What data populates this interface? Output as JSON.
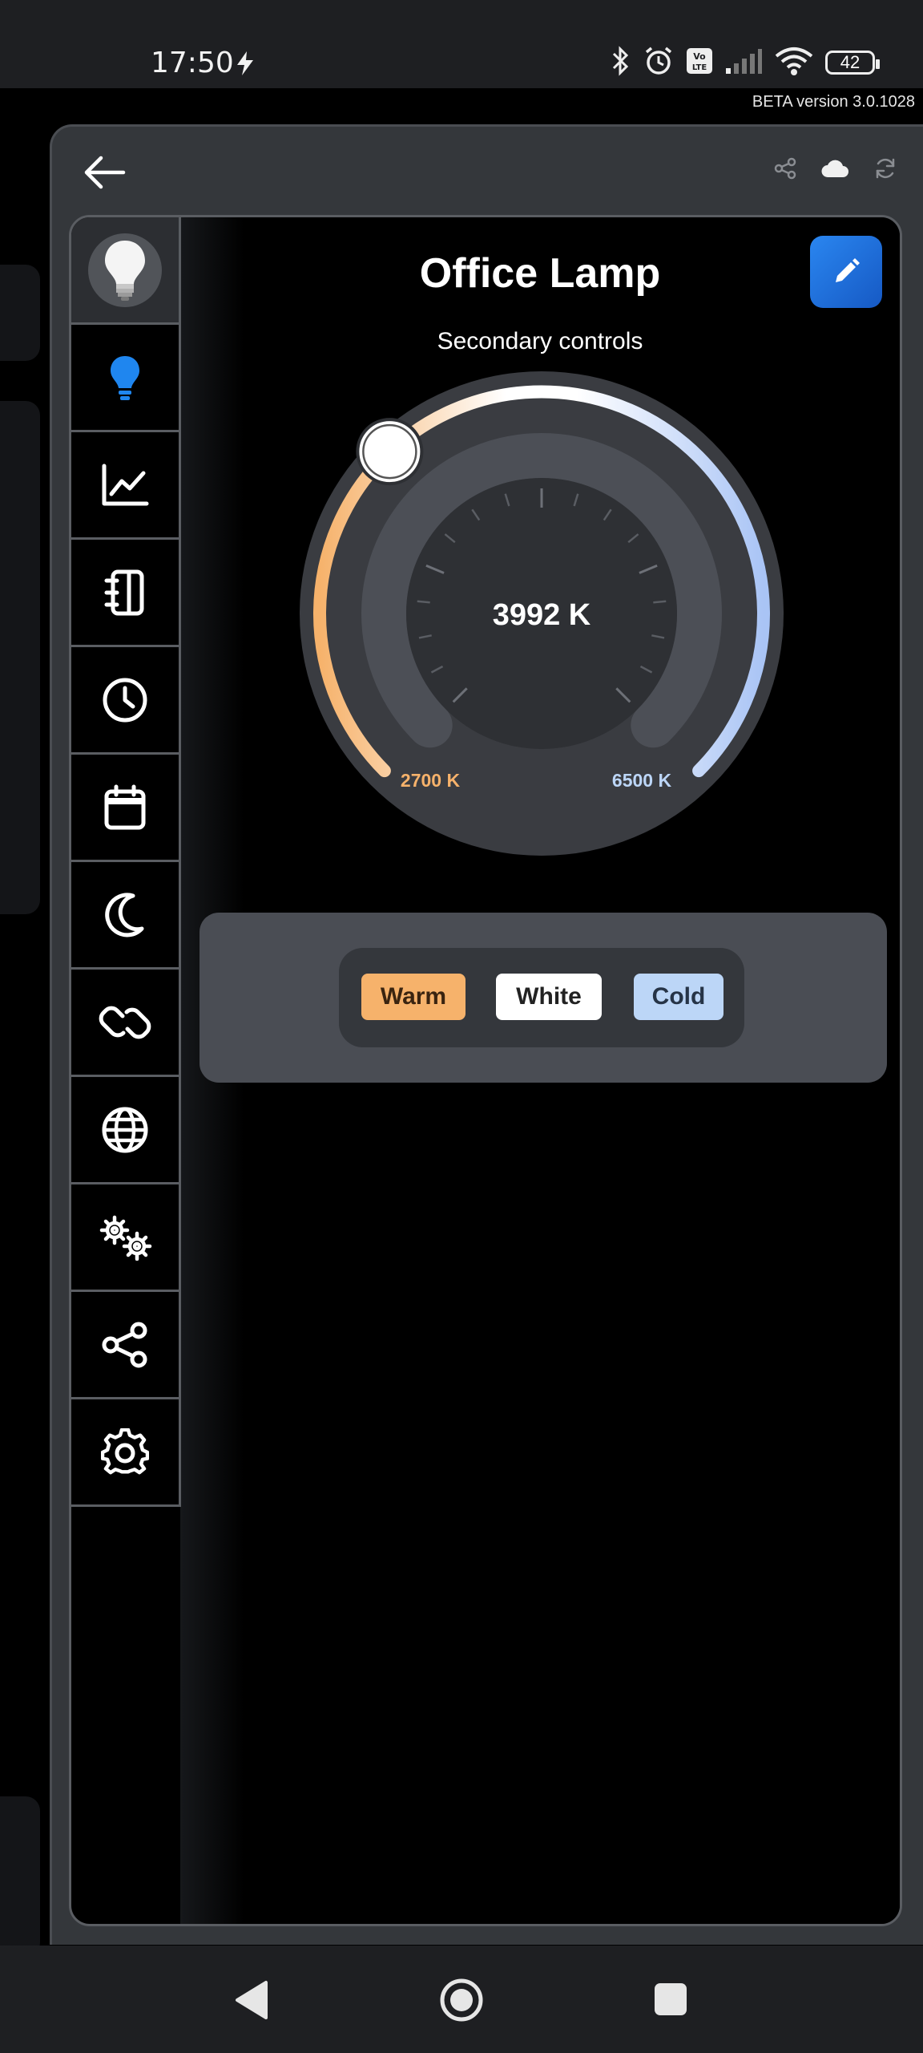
{
  "status_bar": {
    "time": "17:50",
    "battery": "42"
  },
  "beta_label": "BETA version 3.0.1028",
  "device": {
    "title": "Office Lamp",
    "subtitle": "Secondary controls"
  },
  "gauge": {
    "value": 3992,
    "value_label": "3992 K",
    "min": 2700,
    "max": 6500,
    "min_label": "2700 K",
    "max_label": "6500 K",
    "warm_color": "#f6b26b",
    "cold_color": "#a9c4f5"
  },
  "presets": [
    {
      "label": "Warm"
    },
    {
      "label": "White"
    },
    {
      "label": "Cold"
    }
  ],
  "sidebar": {
    "items": [
      {
        "icon": "lightbulb-avatar"
      },
      {
        "icon": "bulb-icon",
        "active": true
      },
      {
        "icon": "chart-icon"
      },
      {
        "icon": "notebook-icon"
      },
      {
        "icon": "clock-icon"
      },
      {
        "icon": "calendar-icon"
      },
      {
        "icon": "moon-icon"
      },
      {
        "icon": "link-icon"
      },
      {
        "icon": "globe-icon"
      },
      {
        "icon": "gears-icon"
      },
      {
        "icon": "share-icon"
      },
      {
        "icon": "settings-icon"
      }
    ]
  },
  "colors": {
    "accent": "#1f76e0",
    "panel_bg": "#34373b"
  }
}
